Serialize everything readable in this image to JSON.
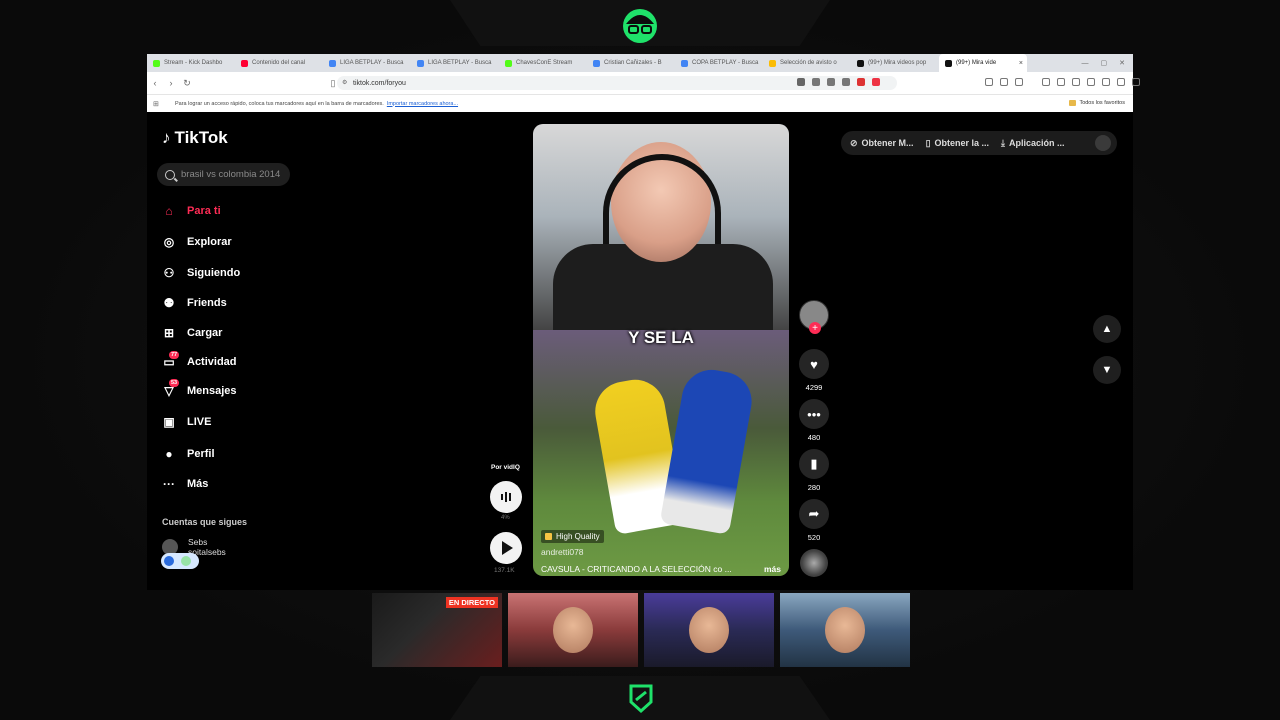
{
  "browser": {
    "tabs": [
      {
        "label": "Stream - Kick Dashbo",
        "color": "#53fc18"
      },
      {
        "label": "Contenido del canal",
        "color": "#ff0033"
      },
      {
        "label": "LIGA BETPLAY - Busca",
        "color": "#4285f4"
      },
      {
        "label": "LIGA BETPLAY - Busca",
        "color": "#4285f4"
      },
      {
        "label": "ChavesConE Stream",
        "color": "#53fc18"
      },
      {
        "label": "Cristian Cañizales - B",
        "color": "#4285f4"
      },
      {
        "label": "COPA BETPLAY - Busca",
        "color": "#4285f4"
      },
      {
        "label": "Selección de avisto o",
        "color": "#fbbc04"
      },
      {
        "label": "(99+) Mira videos pop",
        "color": "#111111"
      },
      {
        "label": "(99+) Mira vide",
        "color": "#111111"
      }
    ],
    "url": "tiktok.com/foryou",
    "bookmarks_text": "Para lograr un acceso rápido, coloca tus marcadores aquí en la barra de marcadores.",
    "bookmarks_link": "Importar marcadores ahora...",
    "all_bookmarks": "Todos los favoritos"
  },
  "tiktok": {
    "logo": "TikTok",
    "search_placeholder": "brasil vs colombia 2014",
    "nav": [
      {
        "label": "Para ti",
        "icon": "home-icon",
        "glyph": "⌂",
        "active": true
      },
      {
        "label": "Explorar",
        "icon": "compass-icon",
        "glyph": "◎"
      },
      {
        "label": "Siguiendo",
        "icon": "following-icon",
        "glyph": "⚇"
      },
      {
        "label": "Friends",
        "icon": "friends-icon",
        "glyph": "⚉"
      },
      {
        "label": "Cargar",
        "icon": "upload-icon",
        "glyph": "⊞"
      },
      {
        "label": "Actividad",
        "icon": "activity-icon",
        "glyph": "▭",
        "badge": "77"
      },
      {
        "label": "Mensajes",
        "icon": "messages-icon",
        "glyph": "▽",
        "badge": "53"
      },
      {
        "label": "LIVE",
        "icon": "live-icon",
        "glyph": "▣"
      },
      {
        "label": "Perfil",
        "icon": "profile-icon",
        "glyph": "●"
      },
      {
        "label": "Más",
        "icon": "more-icon",
        "glyph": "···"
      }
    ],
    "following_header": "Cuentas que sigues",
    "following": [
      {
        "name": "Sebs",
        "handle": "soitalsebs"
      }
    ],
    "video": {
      "caption_overlay": "Y SE LA",
      "quality": "High Quality",
      "author": "andretti078",
      "description": "CAVSULA - CRITICANDO A LA SELECCIÓN co ...",
      "more": "más"
    },
    "actions": {
      "likes": "4299",
      "comments": "480",
      "saves": "280",
      "shares": "520"
    },
    "vidiq": {
      "label": "Por vidIQ",
      "small": "4%",
      "plays": "137.1K"
    },
    "topbar": [
      {
        "label": "Obtener M...",
        "icon": "coin-icon"
      },
      {
        "label": "Obtener la ...",
        "icon": "phone-icon"
      },
      {
        "label": "Aplicación ...",
        "icon": "download-icon"
      }
    ]
  },
  "stream": {
    "live_label": "EN DIRECTO"
  }
}
